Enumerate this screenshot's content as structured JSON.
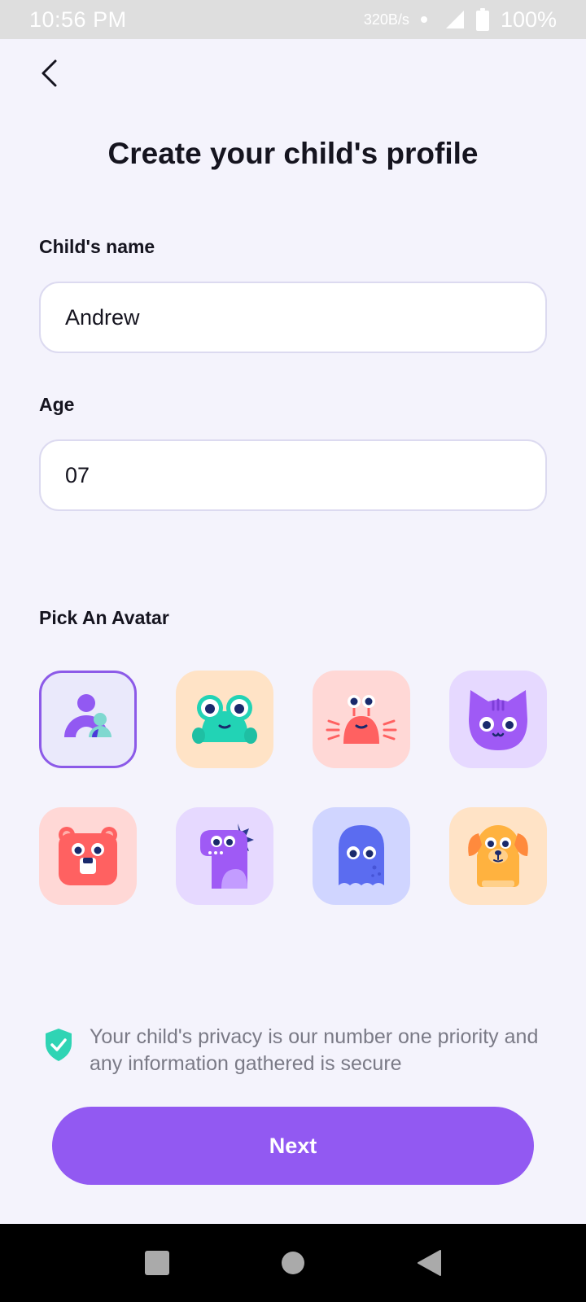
{
  "status_bar": {
    "time": "10:56 PM",
    "network_speed": "320B/s",
    "battery": "100%",
    "icons": [
      "signal-icon",
      "battery-icon"
    ]
  },
  "header": {
    "back_icon": "chevron-left-icon",
    "title": "Create your child's profile"
  },
  "form": {
    "name_label": "Child's name",
    "name_value": "Andrew",
    "age_label": "Age",
    "age_value": "07"
  },
  "avatars": {
    "label": "Pick An Avatar",
    "selected_index": 0,
    "items": [
      {
        "name": "family-avatar",
        "bg": "#eae9fb"
      },
      {
        "name": "frog-avatar",
        "bg": "#ffe3c6"
      },
      {
        "name": "crab-avatar",
        "bg": "#ffd8d6"
      },
      {
        "name": "cat-avatar",
        "bg": "#e6d9ff"
      },
      {
        "name": "bear-avatar",
        "bg": "#ffd8d6"
      },
      {
        "name": "dino-avatar",
        "bg": "#e6d9ff"
      },
      {
        "name": "ghost-avatar",
        "bg": "#d0d5ff"
      },
      {
        "name": "dog-avatar",
        "bg": "#ffe3c6"
      }
    ]
  },
  "privacy": {
    "icon": "shield-check-icon",
    "text": "Your child's privacy is our number one priority and any information gathered is secure"
  },
  "next_button": {
    "label": "Next"
  },
  "colors": {
    "accent": "#9259f2",
    "background": "#f4f3fc",
    "shield": "#2fd4b4"
  }
}
